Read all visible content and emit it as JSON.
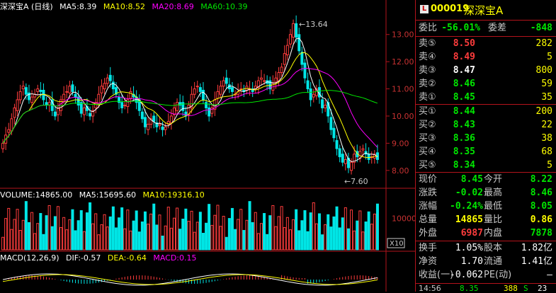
{
  "colors": {
    "up": "#ff3c3c",
    "down": "#00e6e6",
    "ma5": "#ffffff",
    "ma10": "#ffff00",
    "ma20": "#ff00ff",
    "ma60": "#00e600",
    "grid": "#b4131b"
  },
  "kline": {
    "header": {
      "title": "深深宝A (日线)",
      "ma5": "MA5:8.39",
      "ma10": "MA10:8.52",
      "ma20": "MA20:8.69",
      "ma60": "MA60:10.39"
    },
    "price_ticks": [
      "13.00",
      "12.00",
      "11.00",
      "10.00",
      "9.00",
      "8.00"
    ],
    "high_label": "13.64",
    "low_label": "7.60"
  },
  "volume": {
    "header": {
      "title": "VOLUME:14865.00",
      "ma5": "MA5:15695.60",
      "ma10": "MA10:19316.10"
    },
    "tick": "10000",
    "unit_badge": "X10"
  },
  "macd": {
    "header": {
      "title": "MACD(12,26,9)",
      "dif": "DIF:-0.57",
      "dea": "DEA:-0.64",
      "macd": "MACD:0.15"
    }
  },
  "chart_data": {
    "type": "candlestick",
    "title": "深深宝A (日线)",
    "ylim": [
      7.5,
      13.8
    ],
    "price_ticks": [
      13,
      12,
      11,
      10,
      9,
      8
    ],
    "high": 13.64,
    "low": 7.6,
    "closes": [
      9.0,
      9.3,
      9.5,
      9.9,
      10.3,
      10.6,
      10.9,
      11.1,
      10.8,
      10.6,
      10.7,
      10.8,
      11.0,
      10.9,
      10.6,
      10.4,
      10.5,
      10.2,
      10.0,
      10.3,
      10.6,
      10.8,
      10.9,
      11.1,
      10.9,
      10.7,
      10.4,
      10.1,
      10.3,
      10.2,
      10.0,
      10.2,
      10.5,
      10.8,
      11.1,
      11.2,
      11.4,
      11.3,
      11.0,
      10.8,
      10.5,
      10.3,
      10.4,
      10.6,
      10.9,
      10.7,
      10.5,
      10.2,
      9.9,
      9.6,
      9.7,
      9.9,
      9.8,
      9.6,
      9.7,
      9.5,
      9.6,
      9.8,
      10.0,
      10.3,
      10.5,
      10.4,
      10.2,
      10.0,
      10.4,
      10.8,
      11.0,
      11.1,
      10.9,
      10.6,
      10.3,
      10.0,
      10.3,
      10.6,
      10.9,
      11.1,
      11.3,
      11.2,
      11.0,
      10.9,
      10.8,
      10.9,
      11.0,
      10.9,
      11.1,
      11.0,
      10.9,
      11.1,
      11.3,
      11.4,
      11.3,
      11.2,
      11.0,
      11.2,
      11.4,
      11.6,
      11.8,
      12.3,
      12.6,
      13.0,
      13.4,
      12.9,
      12.4,
      11.9,
      11.4,
      11.0,
      10.6,
      10.8,
      11.0,
      10.7,
      10.3,
      10.4,
      10.0,
      9.5,
      9.2,
      8.8,
      8.5,
      8.3,
      8.4,
      8.1,
      8.3,
      8.6,
      8.5,
      8.7,
      8.8,
      8.6,
      8.4,
      8.5,
      8.6,
      8.4
    ],
    "volume_ylim": [
      0,
      16000
    ],
    "macd": {
      "dif": -0.57,
      "dea": -0.64,
      "macd": 0.15
    },
    "indicators": {
      "MA5": 8.39,
      "MA10": 8.52,
      "MA20": 8.69,
      "MA60": 10.39,
      "VOLUME": 14865.0,
      "VOL_MA5": 15695.6,
      "VOL_MA10": 19316.1
    }
  },
  "quote": {
    "badge": "L",
    "code": "000019",
    "name": "深深宝A",
    "weibi": {
      "label": "委比",
      "value": "-56.01%",
      "label2": "委差",
      "value2": "-848"
    },
    "sell": [
      {
        "label": "卖⑤",
        "price": "8.50",
        "vol": "282"
      },
      {
        "label": "卖④",
        "price": "8.49",
        "vol": "5"
      },
      {
        "label": "卖③",
        "price": "8.47",
        "vol": "800"
      },
      {
        "label": "卖②",
        "price": "8.46",
        "vol": "59"
      },
      {
        "label": "卖①",
        "price": "8.45",
        "vol": "35"
      }
    ],
    "buy": [
      {
        "label": "买①",
        "price": "8.44",
        "vol": "200"
      },
      {
        "label": "买②",
        "price": "8.43",
        "vol": "22"
      },
      {
        "label": "买③",
        "price": "8.36",
        "vol": "38"
      },
      {
        "label": "买④",
        "price": "8.35",
        "vol": "68"
      },
      {
        "label": "买⑤",
        "price": "8.34",
        "vol": "5"
      }
    ],
    "stats": [
      {
        "l1": "现价",
        "v1": "8.45",
        "c1": "green",
        "l2": "今开",
        "v2": "8.22",
        "c2": "green"
      },
      {
        "l1": "涨跌",
        "v1": "-0.02",
        "c1": "green",
        "l2": "最高",
        "v2": "8.46",
        "c2": "green"
      },
      {
        "l1": "涨幅",
        "v1": "-0.24%",
        "c1": "green",
        "l2": "最低",
        "v2": "8.05",
        "c2": "green"
      },
      {
        "l1": "总量",
        "v1": "14865",
        "c1": "yellow",
        "l2": "量比",
        "v2": "0.86",
        "c2": "yellow"
      },
      {
        "l1": "外盘",
        "v1": "6987",
        "c1": "red",
        "l2": "内盘",
        "v2": "7878",
        "c2": "green"
      }
    ],
    "info": [
      {
        "l1": "换手",
        "v1": "1.05%",
        "l2": "股本",
        "v2": "1.82亿"
      },
      {
        "l1": "净资",
        "v1": "1.70",
        "l2": "流通",
        "v2": "1.41亿"
      },
      {
        "l1": "收益(一)",
        "v1": "-0.062",
        "l2": "PE(动)",
        "v2": "—"
      }
    ],
    "tick": {
      "time": "14:56",
      "price": "8.35",
      "vol": "388",
      "dir": "S",
      "count": "23"
    }
  }
}
